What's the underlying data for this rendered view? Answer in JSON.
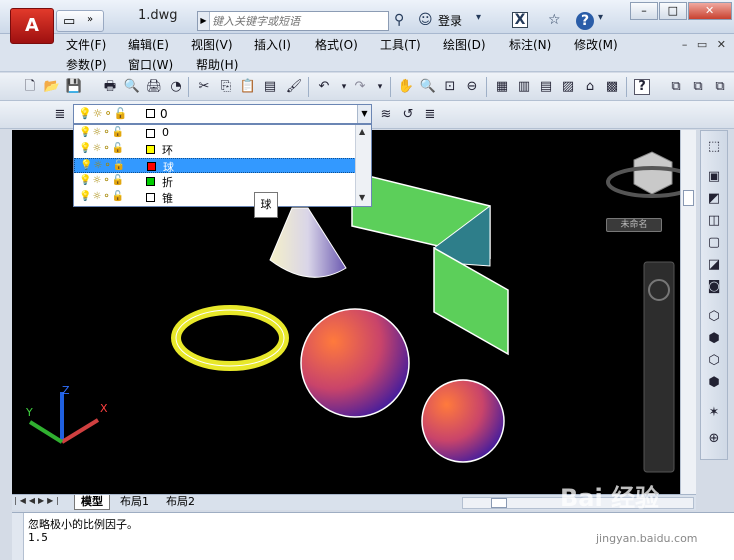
{
  "title_bar": {
    "logo": "A",
    "doc_title": "1.dwg",
    "search_placeholder": "键入关键字或短语",
    "login_label": "登录",
    "help_icon": "?",
    "window_buttons": [
      "–",
      "□",
      "✕"
    ]
  },
  "menu": {
    "row1": [
      "文件(F)",
      "编辑(E)",
      "视图(V)",
      "插入(I)",
      "格式(O)",
      "工具(T)",
      "绘图(D)",
      "标注(N)",
      "修改(M)"
    ],
    "row2": [
      "参数(P)",
      "窗口(W)",
      "帮助(H)"
    ],
    "mdi_controls": [
      "–",
      "▭",
      "✕"
    ]
  },
  "layer_toolbar": {
    "current_layer": "0",
    "state_icons": "💡☼⚬🔓",
    "layers": [
      {
        "name": "0",
        "color": "#ffffff",
        "selected": false
      },
      {
        "name": "环",
        "color": "#ffff00",
        "selected": false
      },
      {
        "name": "球",
        "color": "#ff0000",
        "selected": true
      },
      {
        "name": "折",
        "color": "#00cc00",
        "selected": false
      },
      {
        "name": "锥",
        "color": "#ffffff",
        "selected": false
      }
    ],
    "tooltip": "球"
  },
  "viewcube": {
    "label": "未命名"
  },
  "ucs": {
    "x": "X",
    "y": "Y",
    "z": "Z"
  },
  "layout_tabs": [
    "模型",
    "布局1",
    "布局2"
  ],
  "command_line": {
    "line1": "忽略极小的比例因子。",
    "line2": "1.5"
  },
  "watermark": {
    "main": "Bai 经验",
    "sub": "jingyan.baidu.com"
  }
}
